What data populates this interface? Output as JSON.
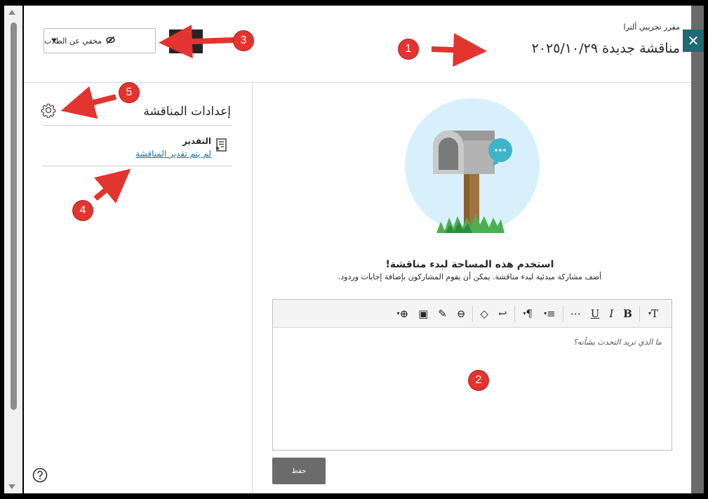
{
  "header": {
    "course_name": "مقرر تجريبي ألترا",
    "discussion_title": "مناقشة جديدة ٢٠٢٥/١٠/٢٩",
    "visibility_label": "مخفي عن الطلاب",
    "close_icon": "close-icon"
  },
  "settings": {
    "title": "إعدادات المناقشة",
    "grading_title": "التقدير",
    "grading_link": "لم يتم تقدير المناقشة",
    "gear_icon": "gear-icon",
    "grading_icon": "grading-icon"
  },
  "main": {
    "empty_title": "استخدم هذه المساحة لبدء مناقشة!",
    "empty_subtitle": "أضف مشاركة مبدئية لبدء مناقشة. يمكن أن يقوم المشاركون بإضافة إجابات وردود.",
    "editor_placeholder": "ما الذي تريد التحدث بشأنه؟",
    "save_label": "حفظ"
  },
  "toolbar": {
    "text_size": "T",
    "bold": "B",
    "italic": "I",
    "underline": "U",
    "more": "⋯",
    "align": "≡",
    "paragraph": "¶",
    "redo": "↩",
    "clear_format": "◇",
    "link": "⊖",
    "attach": "✎",
    "image": "▣",
    "insert": "⊕"
  },
  "callouts": [
    "1",
    "2",
    "3",
    "4",
    "5"
  ],
  "colors": {
    "accent": "#1f6a73",
    "link": "#1a73a8",
    "callout": "#e3342f"
  }
}
